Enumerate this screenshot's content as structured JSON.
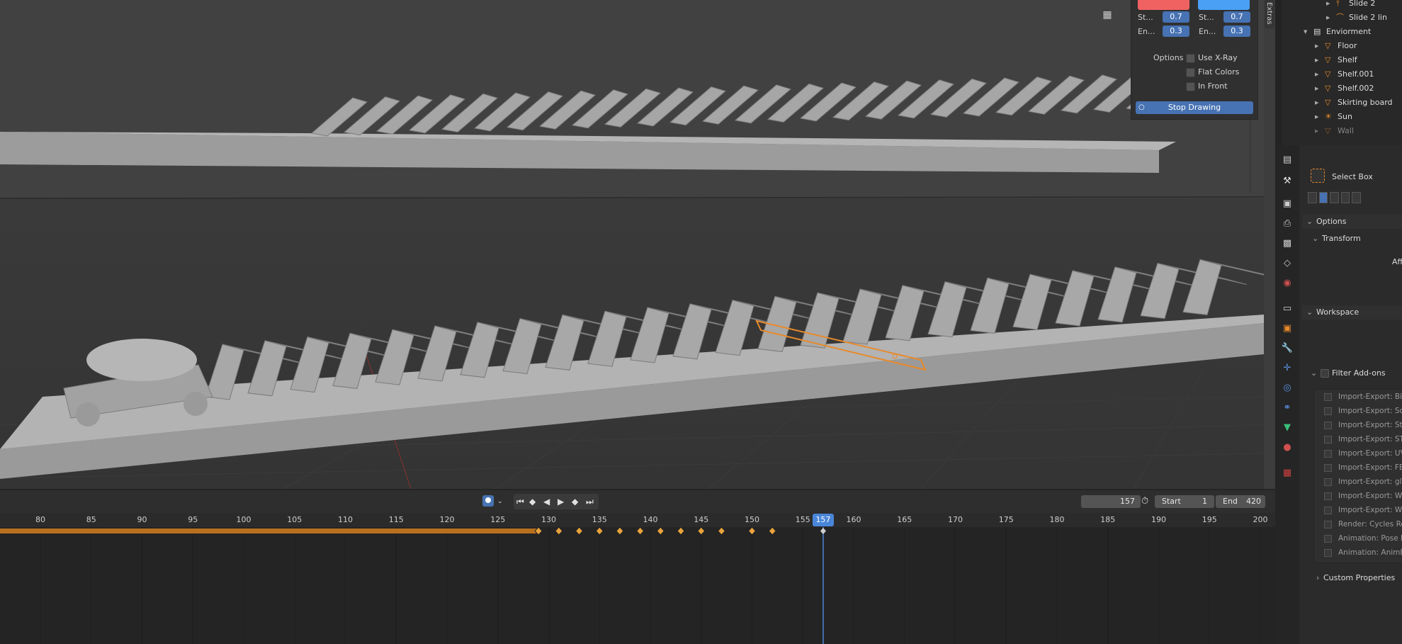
{
  "colors": {
    "accent_blue": "#4772b3",
    "keyframe_orange": "#e8a33c",
    "selection_orange": "#e88a2a",
    "swatch_red": "#f06262",
    "swatch_blue": "#4aa0f5",
    "playhead": "#4a86d8"
  },
  "annotate": {
    "col1": {
      "start_label": "St...",
      "start_value": "0.7",
      "end_label": "En...",
      "end_value": "0.3"
    },
    "col2": {
      "start_label": "St...",
      "start_value": "0.7",
      "end_label": "En...",
      "end_value": "0.3"
    },
    "options_label": "Options",
    "options": [
      "Use X-Ray",
      "Flat Colors",
      "In Front"
    ],
    "stop_button": "Stop Drawing"
  },
  "extras_tab": "Extras",
  "outliner": {
    "items": [
      {
        "name": "Slide 2",
        "icon": "armature-icon"
      },
      {
        "name": "Slide 2 lin",
        "icon": "curve-icon"
      },
      {
        "name": "Enviorment",
        "icon": "collection-icon"
      },
      {
        "name": "Floor",
        "icon": "mesh-icon"
      },
      {
        "name": "Shelf",
        "icon": "mesh-icon"
      },
      {
        "name": "Shelf.001",
        "icon": "mesh-icon"
      },
      {
        "name": "Shelf.002",
        "icon": "mesh-icon"
      },
      {
        "name": "Skirting board",
        "icon": "mesh-icon"
      },
      {
        "name": "Sun",
        "icon": "light-icon"
      },
      {
        "name": "Wall",
        "icon": "mesh-icon"
      }
    ]
  },
  "properties": {
    "tool_name": "Select Box",
    "sections": {
      "options": "Options",
      "transform": "Transform",
      "affect_partial": "Aff",
      "workspace": "Workspace",
      "filter_addons": "Filter Add-ons",
      "custom_properties": "Custom Properties"
    },
    "addons": [
      "Import-Export: BioV",
      "Import-Export: Scal",
      "Import-Export: Stan",
      "Import-Export: STL",
      "Import-Export: UV L",
      "Import-Export: FBX",
      "Import-Export: glTF",
      "Import-Export: Wav",
      "Import-Export: Web",
      "Render: Cycles Ren",
      "Animation: Pose Lib",
      "Animation: AnimEx"
    ]
  },
  "timeline": {
    "current_frame": "157",
    "start_label": "Start",
    "start_value": "1",
    "end_label": "End",
    "end_value": "420",
    "ticks": [
      "80",
      "85",
      "90",
      "95",
      "100",
      "105",
      "110",
      "115",
      "120",
      "125",
      "130",
      "135",
      "140",
      "145",
      "150",
      "155",
      "160",
      "165",
      "170",
      "175",
      "180",
      "185",
      "190",
      "195",
      "200"
    ],
    "keyframes": [
      129,
      131,
      133,
      135,
      137,
      139,
      141,
      143,
      145,
      147,
      150,
      152
    ]
  }
}
